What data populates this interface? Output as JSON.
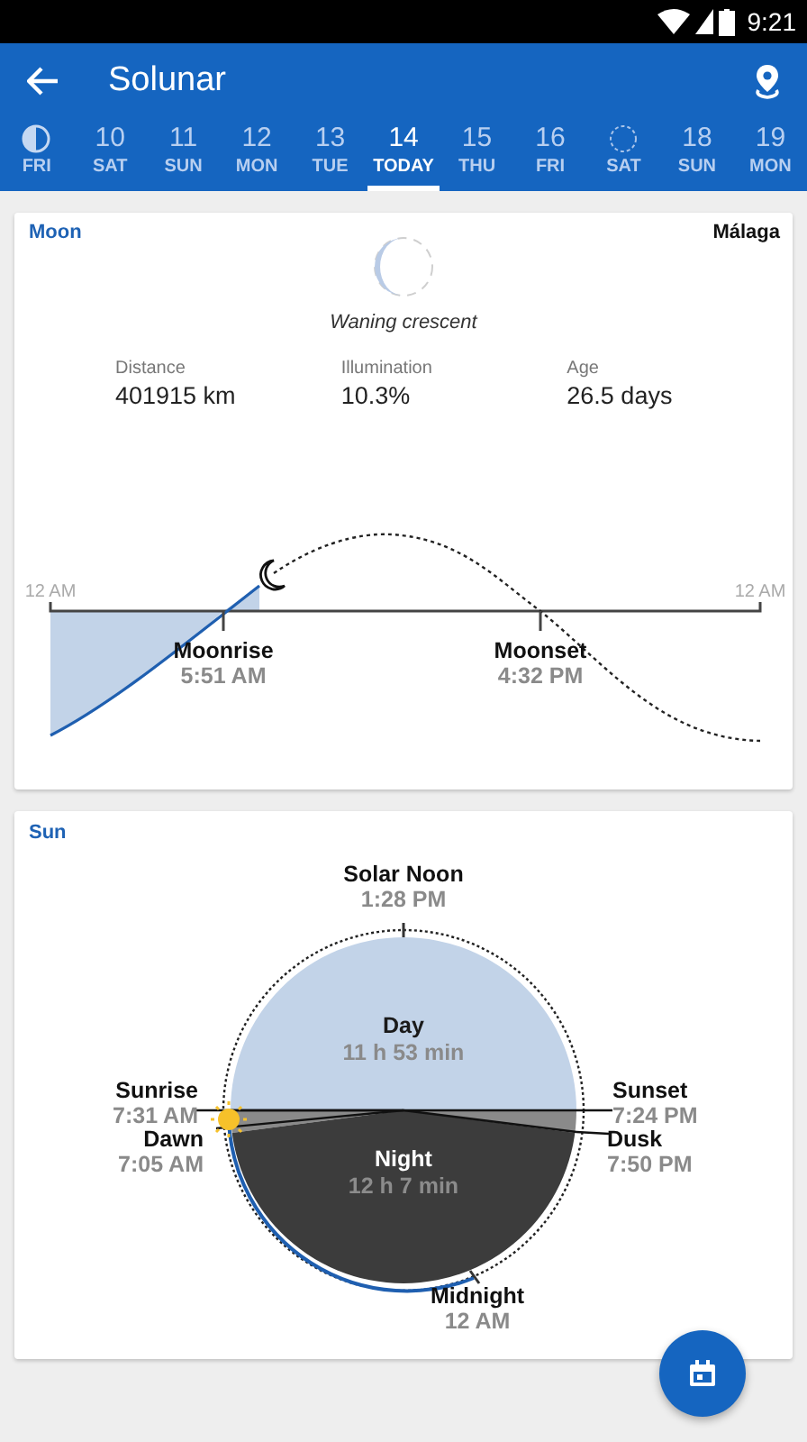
{
  "status_bar": {
    "time": "9:21"
  },
  "app_bar": {
    "title": "Solunar"
  },
  "days": [
    {
      "kind": "half-moon",
      "weekday": "FRI",
      "selected": false
    },
    {
      "kind": "date",
      "day": "10",
      "weekday": "SAT",
      "selected": false
    },
    {
      "kind": "date",
      "day": "11",
      "weekday": "SUN",
      "selected": false
    },
    {
      "kind": "date",
      "day": "12",
      "weekday": "MON",
      "selected": false
    },
    {
      "kind": "date",
      "day": "13",
      "weekday": "TUE",
      "selected": false
    },
    {
      "kind": "date",
      "day": "14",
      "weekday": "TODAY",
      "selected": true
    },
    {
      "kind": "date",
      "day": "15",
      "weekday": "THU",
      "selected": false
    },
    {
      "kind": "date",
      "day": "16",
      "weekday": "FRI",
      "selected": false
    },
    {
      "kind": "new-moon",
      "weekday": "SAT",
      "selected": false
    },
    {
      "kind": "date",
      "day": "18",
      "weekday": "SUN",
      "selected": false
    },
    {
      "kind": "date",
      "day": "19",
      "weekday": "MON",
      "selected": false
    }
  ],
  "moon": {
    "title": "Moon",
    "location": "Málaga",
    "phase": "Waning crescent",
    "stats": [
      {
        "label": "Distance",
        "value": "401915 km"
      },
      {
        "label": "Illumination",
        "value": "10.3%"
      },
      {
        "label": "Age",
        "value": "26.5 days"
      }
    ],
    "axis_labels": [
      "12 AM",
      "12 AM"
    ],
    "events": [
      {
        "kind": "rise",
        "name": "Moonrise",
        "time": "5:51 AM"
      },
      {
        "kind": "set",
        "name": "Moonset",
        "time": "4:32 PM"
      }
    ]
  },
  "sun": {
    "title": "Sun",
    "periods": [
      {
        "kind": "day",
        "name": "Day",
        "duration": "11 h 53 min"
      },
      {
        "kind": "night",
        "name": "Night",
        "duration": "12 h 7 min"
      }
    ],
    "events": [
      {
        "kind": "noon",
        "name": "Solar Noon",
        "time": "1:28 PM"
      },
      {
        "kind": "sunrise",
        "name": "Sunrise",
        "time": "7:31 AM"
      },
      {
        "kind": "dawn",
        "name": "Dawn",
        "time": "7:05 AM"
      },
      {
        "kind": "sunset",
        "name": "Sunset",
        "time": "7:24 PM"
      },
      {
        "kind": "dusk",
        "name": "Dusk",
        "time": "7:50 PM"
      },
      {
        "kind": "midnight",
        "name": "Midnight",
        "time": "12 AM"
      }
    ]
  }
}
